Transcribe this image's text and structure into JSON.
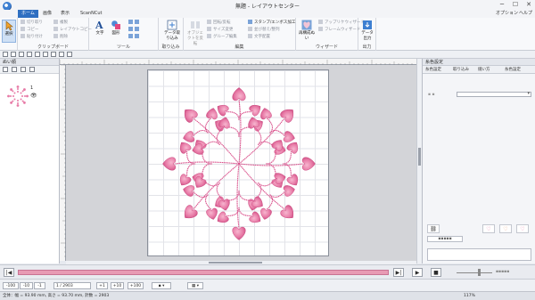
{
  "window": {
    "title": "無題 - レイアウトセンター",
    "minimize": "─",
    "maximize": "☐",
    "close": "✕"
  },
  "ribbon_tabs": [
    {
      "label": "ホーム",
      "active": true
    },
    {
      "label": "画像",
      "active": false
    },
    {
      "label": "表示",
      "active": false
    },
    {
      "label": "ScanNCut",
      "active": false
    }
  ],
  "ribbon_right": {
    "options": "オプション",
    "help": "ヘルプ"
  },
  "groups": {
    "select": {
      "label": "選択",
      "button": "選択"
    },
    "clipboard": {
      "label": "クリップボード",
      "items": [
        "切り取り",
        "コピー",
        "貼り付け",
        "複製",
        "レイアウトコピー",
        "削除"
      ]
    },
    "tools": {
      "label": "ツール",
      "text_button": "文字",
      "shape_button": "図形"
    },
    "import": {
      "label": "取り込み",
      "button": "データ取り込み"
    },
    "edit": {
      "label": "編集",
      "items": [
        "オブジェクトを反転",
        "回転/反転",
        "サイズ変更",
        "グループ編集",
        "並び替え/整列",
        "スタンプ/エンボス加工",
        "ステッチの縫い順を編集",
        "文字配置"
      ]
    },
    "wizard": {
      "label": "ウィザード",
      "button": "再構成ぬい",
      "items": [
        "アップリケウィザード",
        "フレームウィザード"
      ]
    },
    "output": {
      "label": "出力",
      "button": "データ出力"
    }
  },
  "left_panel": {
    "title": "ぬい順",
    "layer_number": "1"
  },
  "right_panel": {
    "title": "糸色設定",
    "tabs": [
      "糸色設定",
      "取り込み",
      "縫い方",
      "糸色設定"
    ]
  },
  "step_bar": {
    "buttons": [
      "-100",
      "-10",
      "-1",
      "+1",
      "+10",
      "+100"
    ],
    "counter": "1 / 2903"
  },
  "status": {
    "size": "全体：幅 = 93.90 mm, 高さ = 93.70 mm, 針数 = 2903",
    "zoom": "117%"
  },
  "colors": {
    "accent": "#2f6fc1",
    "thread_pink": "#e77aa6",
    "thread_dark": "#c9457d",
    "stitch_line": "#d9508b",
    "play_track": "#e89ab4"
  },
  "icons": [
    "app-logo-icon",
    "select-arrow-icon",
    "text-icon",
    "shape-icon",
    "import-icon",
    "heart-icon",
    "output-icon"
  ]
}
